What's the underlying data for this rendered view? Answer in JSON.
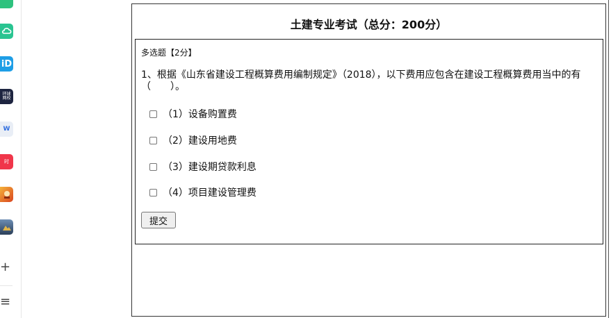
{
  "sidebar": {
    "apps": [
      {
        "name": "app-icon-green-top",
        "color": "#2ec27e"
      },
      {
        "name": "app-icon-cloud",
        "color": "#29c491"
      },
      {
        "name": "app-icon-ip",
        "color": "#1e9ee6"
      },
      {
        "name": "app-icon-news",
        "color": "#1d2440",
        "text": "环球\n网校"
      },
      {
        "name": "app-icon-doc",
        "color": "#e9eef6",
        "text": "W"
      },
      {
        "name": "app-icon-red",
        "color": "#f0364a",
        "text": "时"
      },
      {
        "name": "app-icon-game",
        "color": "#e46b2c"
      },
      {
        "name": "app-icon-landscape",
        "color": "#3a5f8a"
      }
    ],
    "add_icon": "+",
    "menu_icon": "≡"
  },
  "exam": {
    "title": "土建专业考试（总分：200分）",
    "question_type": "多选题【2分】",
    "question_text": "1、根据《山东省建设工程概算费用编制规定》（2018），以下费用应包含在建设工程概算费用当中的有（　　）。",
    "options": [
      "（1）设备购置费",
      "（2）建设用地费",
      "（3）建设期贷款利息",
      "（4）项目建设管理费"
    ],
    "submit_label": "提交"
  }
}
